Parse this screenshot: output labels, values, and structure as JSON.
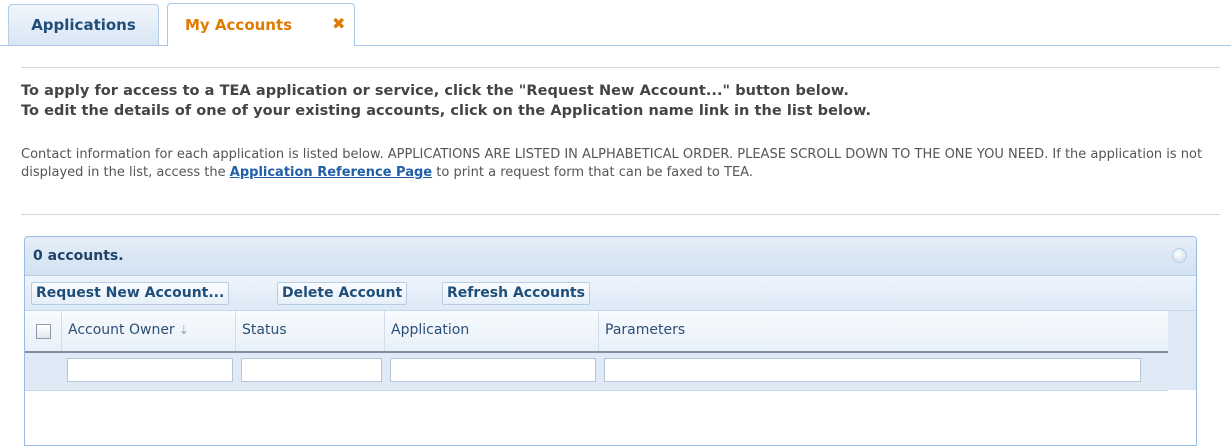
{
  "tabs": {
    "applications_label": "Applications",
    "my_accounts_label": "My Accounts",
    "close_glyph": "✖"
  },
  "instructions": {
    "line1": "To apply for access to a TEA application or service, click the \"Request New Account...\" button below.",
    "line2": "To edit the details of one of your existing accounts, click on the Application name link in the list below."
  },
  "info": {
    "text_before_link": "Contact information for each application is listed below. APPLICATIONS ARE LISTED IN ALPHABETICAL ORDER. PLEASE SCROLL DOWN TO THE ONE YOU NEED. If the application is not displayed in the list, access the ",
    "link_text": "Application Reference Page",
    "text_after_link": " to print a request form that can be faxed to TEA."
  },
  "grid": {
    "title": "0 accounts.",
    "toolbar": {
      "request_label": "Request New Account...",
      "delete_label": "Delete Account",
      "refresh_label": "Refresh Accounts"
    },
    "columns": {
      "owner": "Account Owner",
      "status": "Status",
      "application": "Application",
      "parameters": "Parameters"
    },
    "sort_glyph": "⇣",
    "filters": {
      "owner": "",
      "status": "",
      "application": "",
      "parameters": ""
    }
  },
  "colors": {
    "accent_orange": "#e07a00",
    "link_blue": "#1f5ea8",
    "header_blue": "#1f4e79"
  }
}
